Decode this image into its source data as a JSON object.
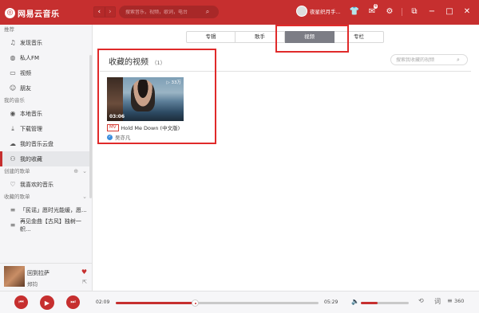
{
  "titlebar": {
    "app_name": "网易云音乐",
    "search_placeholder": "搜索音乐，视频，歌词，电台",
    "username": "夜星织月手...",
    "mail_badge": "4"
  },
  "sidebar": {
    "section_recommend": "推荐",
    "recommend_items": [
      "发现音乐",
      "私人FM",
      "视频",
      "朋友"
    ],
    "section_my_music": "我的音乐",
    "my_music_items": [
      "本地音乐",
      "下载管理",
      "我的音乐云盘",
      "我的收藏"
    ],
    "section_created": "创建的歌单",
    "created_items": [
      "我喜欢的音乐"
    ],
    "section_collected": "收藏的歌单",
    "collected_items": [
      "「民谣」愿时光能缓，愿...",
      "再见金曲【古风】独树一帜..."
    ]
  },
  "now_playing": {
    "title": "回到拉萨",
    "artist": "郑钧"
  },
  "main": {
    "tabs": [
      "专辑",
      "歌手",
      "视频",
      "专栏"
    ],
    "active_tab": "视频",
    "section_title": "收藏的视频",
    "section_count": "（1）",
    "search_placeholder": "搜索我收藏的视频",
    "video": {
      "plays": "33万",
      "duration": "03:06",
      "tag": "MV",
      "title": "Hold Me Down (中文版)",
      "artist": "吴亦凡"
    }
  },
  "player": {
    "current_time": "02:09",
    "total_time": "05:29",
    "progress": 0.39,
    "volume": 0.35,
    "quality": "360"
  },
  "colors": {
    "brand": "#c62f2f",
    "highlight": "#e02a2a"
  }
}
